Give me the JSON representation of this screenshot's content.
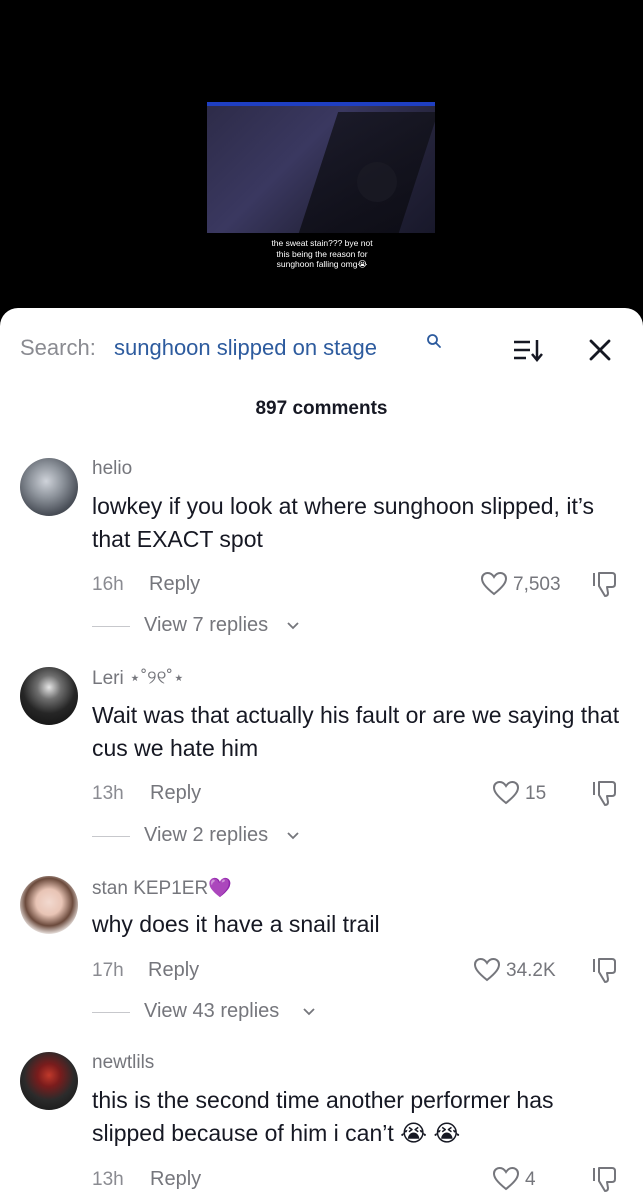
{
  "video": {
    "caption_line1": "the sweat stain??? bye not",
    "caption_line2": "this being the reason for",
    "caption_line3": "sunghoon falling omg😭"
  },
  "search": {
    "label": "Search:",
    "term": "sunghoon slipped on stage"
  },
  "comments_count": "897 comments",
  "comments": [
    {
      "username": "helio",
      "text": "lowkey if you look at where sunghoon slipped, it’s that EXACT spot",
      "time": "16h",
      "reply": "Reply",
      "likes": "7,503",
      "view_replies": "View 7 replies"
    },
    {
      "username": "Leri ⋆˚୨୧˚⋆",
      "text": "Wait was that actually his fault or are we saying that cus we hate him",
      "time": "13h",
      "reply": "Reply",
      "likes": "15",
      "view_replies": "View 2 replies"
    },
    {
      "username": "stan KEP1ER💜",
      "text": "why does it have a snail trail",
      "time": "17h",
      "reply": "Reply",
      "likes": "34.2K",
      "view_replies": "View 43 replies"
    },
    {
      "username": "newtlils",
      "text": "this is the second time another performer has slipped because of him i can’t 😭 😭",
      "time": "13h",
      "reply": "Reply",
      "likes": "4",
      "view_replies": ""
    }
  ],
  "icons": {
    "search_glyph": "magnifier-icon",
    "sort": "sort-icon",
    "close": "close-icon",
    "like": "heart-icon",
    "dislike": "dislike-icon",
    "chevron": "chevron-down-icon"
  },
  "colors": {
    "search_term": "#2d5b9e",
    "muted_text": "#75767c",
    "primary_text": "#161823",
    "sheet_bg": "#ffffff",
    "video_bg": "#000000"
  }
}
